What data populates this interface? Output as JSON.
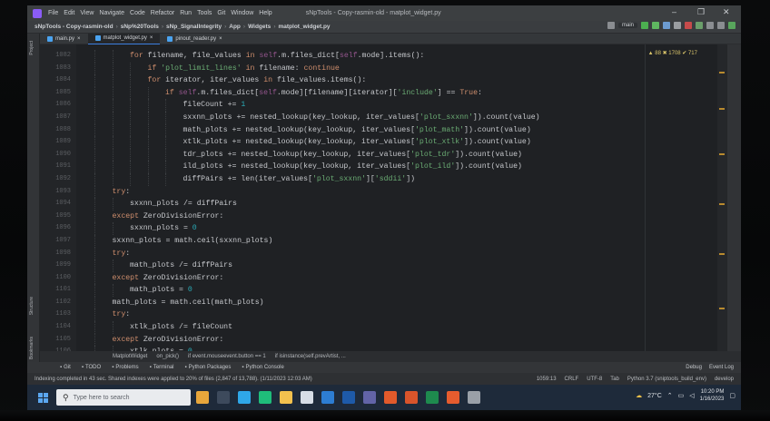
{
  "titlebar": {
    "menus": [
      "File",
      "Edit",
      "View",
      "Navigate",
      "Code",
      "Refactor",
      "Run",
      "Tools",
      "Git",
      "Window",
      "Help"
    ],
    "title": "sNpTools - Copy-rasmin-old - matplot_widget.py"
  },
  "navbar": {
    "crumbs": [
      "sNpTools - Copy-rasmin-old",
      "sNp%20Tools",
      "sNp_SignalIntegrity",
      "App",
      "Widgets",
      "matplot_widget.py"
    ],
    "run_config": "main"
  },
  "tabs": [
    "main.py",
    "matplot_widget.py",
    "pinout_reader.py"
  ],
  "left_strip": [
    "Project",
    "Structure",
    "Bookmarks"
  ],
  "editor": {
    "inspection": "▲ 88  ✖ 1708  ✔ 717",
    "lines": [
      {
        "ln": "1082",
        "indent": 2,
        "text": "for filename, file_values in self.m.files_dict[self.mode].items():"
      },
      {
        "ln": "1083",
        "indent": 3,
        "text": "if 'plot_limit_lines' in filename: continue"
      },
      {
        "ln": "1084",
        "indent": 3,
        "text": "for iterator, iter_values in file_values.items():"
      },
      {
        "ln": "1085",
        "indent": 4,
        "text": "if self.m.files_dict[self.mode][filename][iterator]['include'] == True:"
      },
      {
        "ln": "1086",
        "indent": 5,
        "text": "fileCount += 1"
      },
      {
        "ln": "1087",
        "indent": 5,
        "text": "sxxnn_plots += nested_lookup(key_lookup, iter_values['plot_sxxnn']).count(value)"
      },
      {
        "ln": "1088",
        "indent": 5,
        "text": "math_plots += nested_lookup(key_lookup, iter_values['plot_math']).count(value)"
      },
      {
        "ln": "1089",
        "indent": 5,
        "text": "xtlk_plots += nested_lookup(key_lookup, iter_values['plot_xtlk']).count(value)"
      },
      {
        "ln": "1090",
        "indent": 5,
        "text": "tdr_plots += nested_lookup(key_lookup, iter_values['plot_tdr']).count(value)"
      },
      {
        "ln": "1091",
        "indent": 5,
        "text": "ild_plots += nested_lookup(key_lookup, iter_values['plot_ild']).count(value)"
      },
      {
        "ln": "1092",
        "indent": 5,
        "text": "diffPairs += len(iter_values['plot_sxxnn']['sddii'])"
      },
      {
        "ln": "1093",
        "indent": 1,
        "text": "try:"
      },
      {
        "ln": "1094",
        "indent": 2,
        "text": "sxxnn_plots /= diffPairs"
      },
      {
        "ln": "1095",
        "indent": 1,
        "text": "except ZeroDivisionError:"
      },
      {
        "ln": "1096",
        "indent": 2,
        "text": "sxxnn_plots = 0"
      },
      {
        "ln": "1097",
        "indent": 1,
        "text": "sxxnn_plots = math.ceil(sxxnn_plots)"
      },
      {
        "ln": "1098",
        "indent": 1,
        "text": "try:"
      },
      {
        "ln": "1099",
        "indent": 2,
        "text": "math_plots /= diffPairs"
      },
      {
        "ln": "1100",
        "indent": 1,
        "text": "except ZeroDivisionError:"
      },
      {
        "ln": "1101",
        "indent": 2,
        "text": "math_plots = 0"
      },
      {
        "ln": "1102",
        "indent": 1,
        "text": "math_plots = math.ceil(math_plots)"
      },
      {
        "ln": "1103",
        "indent": 1,
        "text": "try:"
      },
      {
        "ln": "1104",
        "indent": 2,
        "text": "xtlk_plots /= fileCount"
      },
      {
        "ln": "1105",
        "indent": 1,
        "text": "except ZeroDivisionError:"
      },
      {
        "ln": "1106",
        "indent": 2,
        "text": "xtlk_plots = 0"
      }
    ]
  },
  "code_breadcrumbs": [
    "MatplotWidget",
    "on_pick()",
    "if event.mouseevent.button == 1",
    "if isinstance(self.prevArtist, ..."
  ],
  "tool_windows": {
    "left": [
      "Git",
      "TODO",
      "Problems",
      "Terminal",
      "Python Packages",
      "Python Console"
    ],
    "right": [
      "Debug",
      "Event Log"
    ]
  },
  "status": {
    "message": "Indexing completed in 43 sec. Shared indexes were applied to 20% of files (2,847 of 13,788). (1/11/2023 12:03 AM)",
    "position": "1059:13",
    "line_sep": "CRLF",
    "encoding": "UTF-8",
    "indent": "Tab",
    "interpreter": "Python 3.7 (sniptools_build_env)",
    "branch": "develop"
  },
  "taskbar": {
    "search_placeholder": "Type here to search",
    "temperature": "27°C",
    "time": "10:20 PM",
    "date": "1/16/2023"
  },
  "colors": {
    "keyword": "#cf8e6d",
    "string": "#6aab73",
    "self": "#94558d",
    "number": "#2aacb8",
    "accent": "#3d7fe0"
  }
}
